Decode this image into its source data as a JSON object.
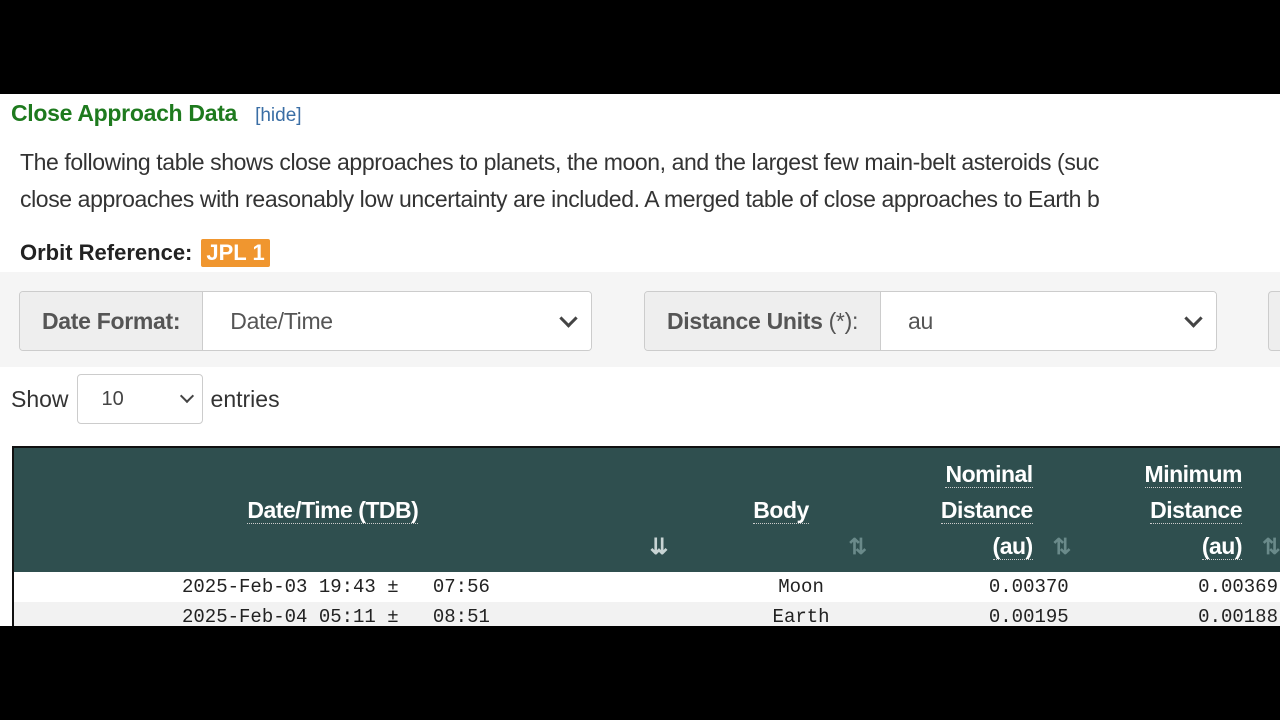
{
  "section": {
    "title": "Close Approach Data",
    "hide_link": "[hide]"
  },
  "intro": {
    "line1": "The following table shows close approaches to planets, the moon, and the largest few main-belt asteroids (suc",
    "line2": "close approaches with reasonably low uncertainty are included. A merged table of close approaches to Earth b"
  },
  "orbit_reference": {
    "label": "Orbit Reference:",
    "value": "JPL 1",
    "badge_color": "#f0962f"
  },
  "controls": {
    "date_format": {
      "label": "Date Format:",
      "selected": "Date/Time"
    },
    "distance_units": {
      "label": "Distance Units",
      "label_suffix": "(*):",
      "selected": "au"
    }
  },
  "length_menu": {
    "prefix": "Show",
    "selected": "10",
    "suffix": "entries"
  },
  "table": {
    "header_color": "#2f4f4f",
    "columns": [
      {
        "label": "Date/Time (TDB)",
        "sort_state": "descending"
      },
      {
        "label": "Body",
        "sort_state": "none"
      },
      {
        "label_lines": [
          "Nominal",
          "Distance",
          "(au)"
        ],
        "sort_state": "none"
      },
      {
        "label_lines": [
          "Minimum",
          "Distance",
          "(au)"
        ],
        "sort_state": "none"
      }
    ],
    "rows": [
      {
        "date": "2025-Feb-03 19:43 ±",
        "uncertainty": "07:56",
        "body": "Moon",
        "nominal": "0.00370",
        "minimum": "0.00369"
      },
      {
        "date": "2025-Feb-04 05:11 ±",
        "uncertainty": "08:51",
        "body": "Earth",
        "nominal": "0.00195",
        "minimum": "0.00188"
      }
    ]
  },
  "icons": {
    "sort_active": "⇊",
    "sort_both": "⇅"
  }
}
